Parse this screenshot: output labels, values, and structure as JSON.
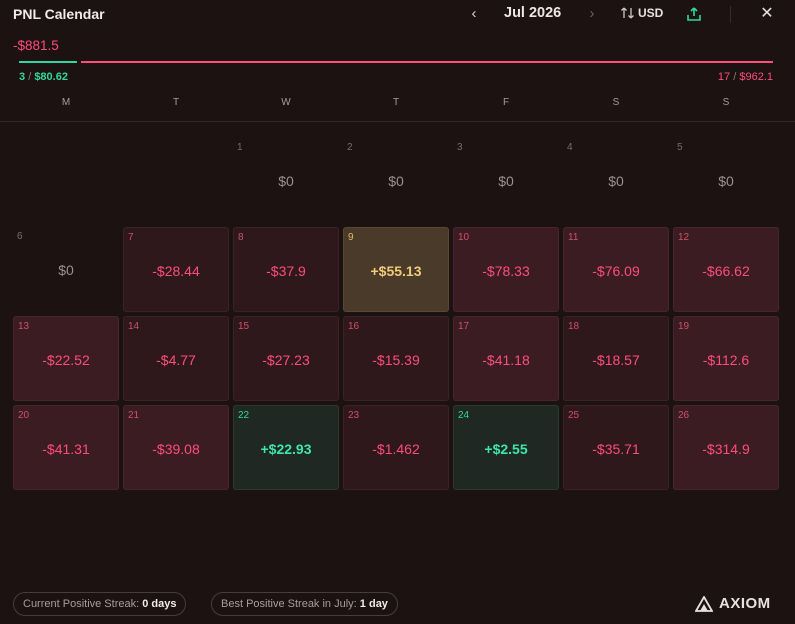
{
  "header": {
    "title": "PNL Calendar",
    "month": "Jul 2026",
    "currency": "USD"
  },
  "summary": {
    "total": "-$881.5",
    "wins_count": "3",
    "wins_amount": "$80.62",
    "losses_count": "17",
    "losses_amount": "$962.1",
    "separator": "/"
  },
  "colors": {
    "negative": "#ff4d7a",
    "positive": "#2fd8a0",
    "highlight": "#f0cc7a",
    "background": "#1c1212"
  },
  "weekdays": [
    "M",
    "T",
    "W",
    "T",
    "F",
    "S",
    "S"
  ],
  "days": [
    {
      "day": "1",
      "value": "$0",
      "type": "empty"
    },
    {
      "day": "2",
      "value": "$0",
      "type": "empty"
    },
    {
      "day": "3",
      "value": "$0",
      "type": "empty"
    },
    {
      "day": "4",
      "value": "$0",
      "type": "empty"
    },
    {
      "day": "5",
      "value": "$0",
      "type": "empty"
    },
    {
      "day": "6",
      "value": "$0",
      "type": "empty"
    },
    {
      "day": "7",
      "value": "-$28.44",
      "type": "neg2"
    },
    {
      "day": "8",
      "value": "-$37.9",
      "type": "neg2"
    },
    {
      "day": "9",
      "value": "+$55.13",
      "type": "gold"
    },
    {
      "day": "10",
      "value": "-$78.33",
      "type": "neg"
    },
    {
      "day": "11",
      "value": "-$76.09",
      "type": "neg"
    },
    {
      "day": "12",
      "value": "-$66.62",
      "type": "neg"
    },
    {
      "day": "13",
      "value": "-$22.52",
      "type": "neg"
    },
    {
      "day": "14",
      "value": "-$4.77",
      "type": "neg2"
    },
    {
      "day": "15",
      "value": "-$27.23",
      "type": "neg2"
    },
    {
      "day": "16",
      "value": "-$15.39",
      "type": "neg2"
    },
    {
      "day": "17",
      "value": "-$41.18",
      "type": "neg"
    },
    {
      "day": "18",
      "value": "-$18.57",
      "type": "neg2"
    },
    {
      "day": "19",
      "value": "-$112.6",
      "type": "neg"
    },
    {
      "day": "20",
      "value": "-$41.31",
      "type": "neg"
    },
    {
      "day": "21",
      "value": "-$39.08",
      "type": "neg"
    },
    {
      "day": "22",
      "value": "+$22.93",
      "type": "pos"
    },
    {
      "day": "23",
      "value": "-$1.462",
      "type": "neg2"
    },
    {
      "day": "24",
      "value": "+$2.55",
      "type": "pos"
    },
    {
      "day": "25",
      "value": "-$35.71",
      "type": "neg2"
    },
    {
      "day": "26",
      "value": "-$314.9",
      "type": "neg"
    }
  ],
  "footer": {
    "current_streak_label": "Current Positive Streak:",
    "current_streak_value": "0 days",
    "best_streak_label": "Best Positive Streak in July:",
    "best_streak_value": "1 day",
    "brand": "AXIOM"
  }
}
